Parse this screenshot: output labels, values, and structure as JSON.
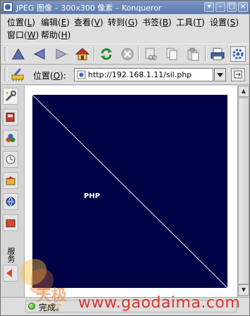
{
  "window": {
    "title": "JPEG 图像 – 300x300 像素 – Konqueror",
    "buttons": {
      "menu": "▾",
      "minimize": "–",
      "maximize": "□",
      "close": "×"
    }
  },
  "menubar": {
    "row1": [
      {
        "name": "location",
        "label": "位置(",
        "acc": "L",
        "end": ")"
      },
      {
        "name": "edit",
        "label": "编辑(",
        "acc": "E",
        "end": ")"
      },
      {
        "name": "view",
        "label": "查看(",
        "acc": "V",
        "end": ")"
      },
      {
        "name": "go",
        "label": "转到(",
        "acc": "G",
        "end": ")"
      },
      {
        "name": "bookmarks",
        "label": "书签(",
        "acc": "B",
        "end": ")"
      },
      {
        "name": "tools",
        "label": "工具(",
        "acc": "T",
        "end": ")"
      },
      {
        "name": "settings",
        "label": "设置(",
        "acc": "S",
        "end": ")"
      }
    ],
    "row2": [
      {
        "name": "window",
        "label": "窗口(",
        "acc": "W",
        "end": ")"
      },
      {
        "name": "help",
        "label": "帮助(",
        "acc": "H",
        "end": ")"
      }
    ]
  },
  "toolbar": {
    "icons": [
      "up-arrow-icon",
      "back-icon",
      "forward-icon",
      "home-icon",
      "reload-icon",
      "stop-icon",
      "cut-icon",
      "copy-icon",
      "paste-icon",
      "print-icon",
      "kde-gear-icon"
    ]
  },
  "location": {
    "label": "位置(",
    "acc": "O",
    "end": "):",
    "url": "http://192.168.1.11/sil.php"
  },
  "sidebar": {
    "tab_label": "服务"
  },
  "image": {
    "text": "PHP",
    "background": "#000044"
  },
  "status": {
    "text": "完成。"
  },
  "watermark": {
    "brand": "天极",
    "small": "com",
    "site": "www.gaodaima.com"
  }
}
